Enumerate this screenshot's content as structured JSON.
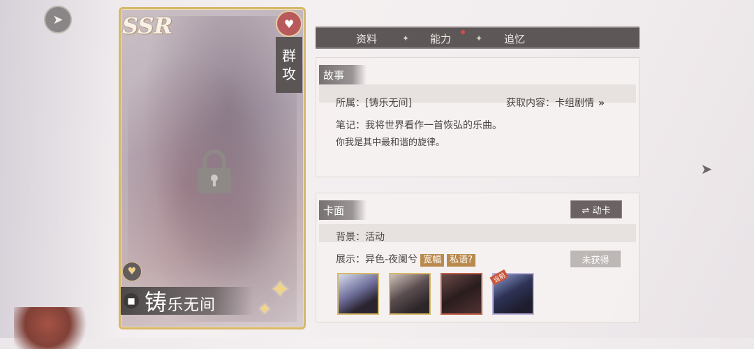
{
  "nav": {
    "back_icon": "back-arrow-icon",
    "next_icon": "next-arrow-icon"
  },
  "card": {
    "rarity": "SSR",
    "attack_type_line1": "群",
    "attack_type_line2": "攻",
    "name_first_char": "铸",
    "name_rest": "乐无间",
    "locked": true
  },
  "tabs": [
    {
      "label": "资料",
      "active": true
    },
    {
      "label": "能力",
      "has_notification": true
    },
    {
      "label": "追忆"
    }
  ],
  "story": {
    "header": "故事",
    "belongs_label": "所属：",
    "belongs_value": "[铸乐无间]",
    "obtain_label": "获取内容：",
    "obtain_value": "卡组剧情",
    "obtain_chevron": "»",
    "note_label": "笔记：",
    "note_line1": "我将世界看作一首恢弘的乐曲。",
    "note_line2": "你我是其中最和谐的旋律。"
  },
  "face": {
    "header": "卡面",
    "dynamic_button": "⇌ 动卡",
    "background_label": "背景：",
    "background_value": "活动",
    "display_label": "展示：",
    "display_value": "异色-夜阑兮",
    "chip_wide": "宽幅",
    "chip_whisper": "私语",
    "help_glyph": "?",
    "unobtained_button": "未获得",
    "current_tag": "当前"
  },
  "colors": {
    "accent_gold": "#d7b86a",
    "tab_bar": "#5e5758",
    "chip": "#b98a4e",
    "notification": "#d94a4a"
  }
}
